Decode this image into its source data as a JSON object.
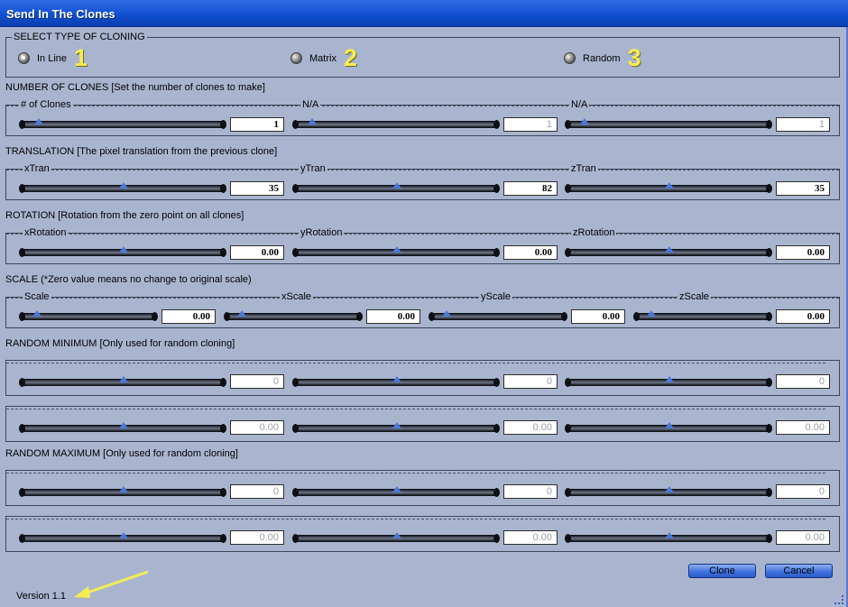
{
  "window": {
    "title": "Send In The Clones"
  },
  "cloning_type": {
    "legend": "SELECT TYPE OF CLONING",
    "options": [
      {
        "label": "In Line",
        "number": "1",
        "selected": true
      },
      {
        "label": "Matrix",
        "number": "2",
        "selected": false
      },
      {
        "label": "Random",
        "number": "3",
        "selected": false
      }
    ],
    "number_color": "#f6ec52"
  },
  "number_of_clones": {
    "label": "NUMBER OF CLONES [Set the number of clones to make]",
    "sliders": [
      {
        "label": "# of Clones",
        "value": "1",
        "enabled": true
      },
      {
        "label": "N/A",
        "value": "1",
        "enabled": false
      },
      {
        "label": "N/A",
        "value": "1",
        "enabled": false
      }
    ]
  },
  "translation": {
    "label": "TRANSLATION [The pixel translation from the previous clone]",
    "sliders": [
      {
        "label": "xTran",
        "value": "35",
        "enabled": true
      },
      {
        "label": "yTran",
        "value": "82",
        "enabled": true
      },
      {
        "label": "zTran",
        "value": "35",
        "enabled": true
      }
    ]
  },
  "rotation": {
    "label": "ROTATION [Rotation from the zero point on all clones]",
    "sliders": [
      {
        "label": "xRotation",
        "value": "0.00",
        "enabled": true
      },
      {
        "label": "yRotation",
        "value": "0.00",
        "enabled": true
      },
      {
        "label": "zRotation",
        "value": "0.00",
        "enabled": true
      }
    ]
  },
  "scale": {
    "label": "SCALE (*Zero value means no change to original scale)",
    "sliders": [
      {
        "label": "Scale",
        "value": "0.00",
        "enabled": true
      },
      {
        "label": "xScale",
        "value": "0.00",
        "enabled": true
      },
      {
        "label": "yScale",
        "value": "0.00",
        "enabled": true
      },
      {
        "label": "zScale",
        "value": "0.00",
        "enabled": true
      }
    ]
  },
  "random_minimum": {
    "label": "RANDOM MINIMUM [Only used for random cloning]",
    "row1": [
      "0",
      "0",
      "0"
    ],
    "row2": [
      "0.00",
      "0.00",
      "0.00"
    ]
  },
  "random_maximum": {
    "label": "RANDOM MAXIMUM [Only used for random cloning]",
    "row1": [
      "0",
      "0",
      "0"
    ],
    "row2": [
      "0.00",
      "0.00",
      "0.00"
    ]
  },
  "buttons": {
    "clone": "Clone",
    "cancel": "Cancel"
  },
  "footer": {
    "version": "Version 1.1"
  },
  "colors": {
    "title_bar": "#1150d2",
    "background": "#a9b5cf",
    "arrow": "#f6ec52"
  }
}
